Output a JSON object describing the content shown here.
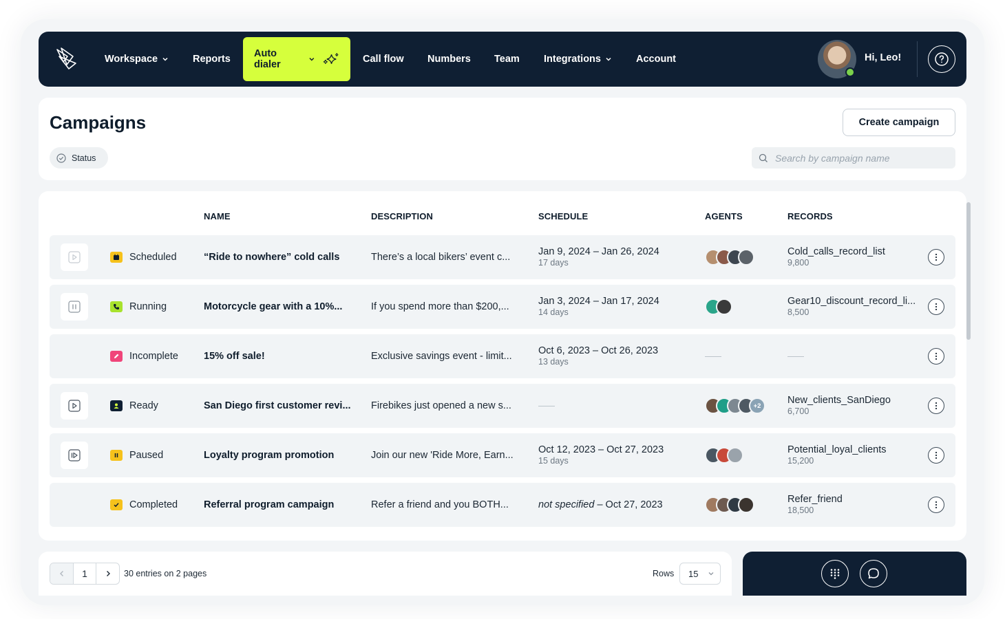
{
  "nav": {
    "items": [
      {
        "label": "Workspace",
        "has_menu": true
      },
      {
        "label": "Reports",
        "has_menu": false
      },
      {
        "label": "Auto dialer",
        "has_menu": true,
        "active": true
      },
      {
        "label": "Call flow",
        "has_menu": false
      },
      {
        "label": "Numbers",
        "has_menu": false
      },
      {
        "label": "Team",
        "has_menu": false
      },
      {
        "label": "Integrations",
        "has_menu": true
      },
      {
        "label": "Account",
        "has_menu": false
      }
    ],
    "greeting": "Hi, Leo!",
    "accent_color": "#d6ff3c",
    "bg_color": "#0f1f33"
  },
  "page": {
    "title": "Campaigns",
    "create_button": "Create campaign",
    "status_filter": "Status",
    "search_placeholder": "Search by campaign name"
  },
  "table": {
    "headers": [
      "NAME",
      "DESCRIPTION",
      "SCHEDULE",
      "AGENTS",
      "RECORDS"
    ],
    "rows": [
      {
        "control": "play",
        "status": "Scheduled",
        "status_color": "#f6c21c",
        "status_icon": "calendar-icon",
        "name": "“Ride to nowhere” cold calls",
        "description": "There’s a local bikers’ event c...",
        "schedule": "Jan 9, 2024 – Jan 26, 2024",
        "schedule_note": "",
        "duration": "17 days",
        "agents": 4,
        "agents_extra": "",
        "record": "Cold_calls_record_list",
        "record_count": "9,800"
      },
      {
        "control": "pause",
        "status": "Running",
        "status_color": "#a8e22e",
        "status_icon": "phone-icon",
        "name": "Motorcycle gear with a 10%...",
        "description": "If you spend more than $200,...",
        "schedule": "Jan 3, 2024 – Jan 17, 2024",
        "schedule_note": "",
        "duration": "14 days",
        "agents": 2,
        "agents_extra": "",
        "record": "Gear10_discount_record_li...",
        "record_count": "8,500"
      },
      {
        "control": "none",
        "status": "Incomplete",
        "status_color": "#f0457a",
        "status_icon": "pencil-icon",
        "name": "15% off sale!",
        "description": "Exclusive savings event - limit...",
        "schedule": "Oct 6, 2023 – Oct 26, 2023",
        "schedule_note": "",
        "duration": "13 days",
        "agents": 0,
        "agents_extra": "",
        "record": "",
        "record_count": ""
      },
      {
        "control": "play",
        "status": "Ready",
        "status_color": "#0f1f33",
        "status_icon": "user-icon",
        "name": "San Diego first customer revi...",
        "description": "Firebikes just opened a new s...",
        "schedule": "",
        "schedule_note": "",
        "duration": "",
        "agents": 4,
        "agents_extra": "+2",
        "record": "New_clients_SanDiego",
        "record_count": "6,700"
      },
      {
        "control": "resume",
        "status": "Paused",
        "status_color": "#f6c21c",
        "status_icon": "pause-icon",
        "name": "Loyalty program promotion",
        "description": "Join our new 'Ride More, Earn...",
        "schedule": "Oct 12, 2023 – Oct 27, 2023",
        "schedule_note": "",
        "duration": "15 days",
        "agents": 3,
        "agents_extra": "",
        "record": "Potential_loyal_clients",
        "record_count": "15,200"
      },
      {
        "control": "none",
        "status": "Completed",
        "status_color": "#f6c21c",
        "status_icon": "check-icon",
        "name": "Referral program campaign",
        "description": "Refer a friend and you BOTH...",
        "schedule": " – Oct 27, 2023",
        "schedule_note": "not specified",
        "duration": "",
        "agents": 4,
        "agents_extra": "",
        "record": "Refer_friend",
        "record_count": "18,500"
      }
    ]
  },
  "pagination": {
    "current_page": "1",
    "summary": "30 entries on 2 pages",
    "rows_label": "Rows",
    "rows_value": "15"
  }
}
